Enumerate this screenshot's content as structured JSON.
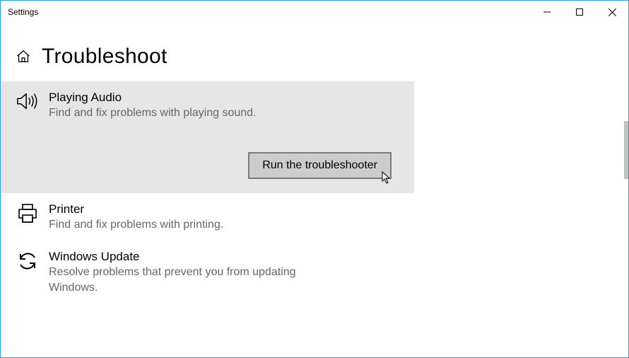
{
  "window": {
    "title": "Settings"
  },
  "header": {
    "title": "Troubleshoot"
  },
  "items": [
    {
      "title": "Playing Audio",
      "desc": "Find and fix problems with playing sound.",
      "expanded": true,
      "action_label": "Run the troubleshooter"
    },
    {
      "title": "Printer",
      "desc": "Find and fix problems with printing."
    },
    {
      "title": "Windows Update",
      "desc": "Resolve problems that prevent you from updating Windows."
    }
  ]
}
